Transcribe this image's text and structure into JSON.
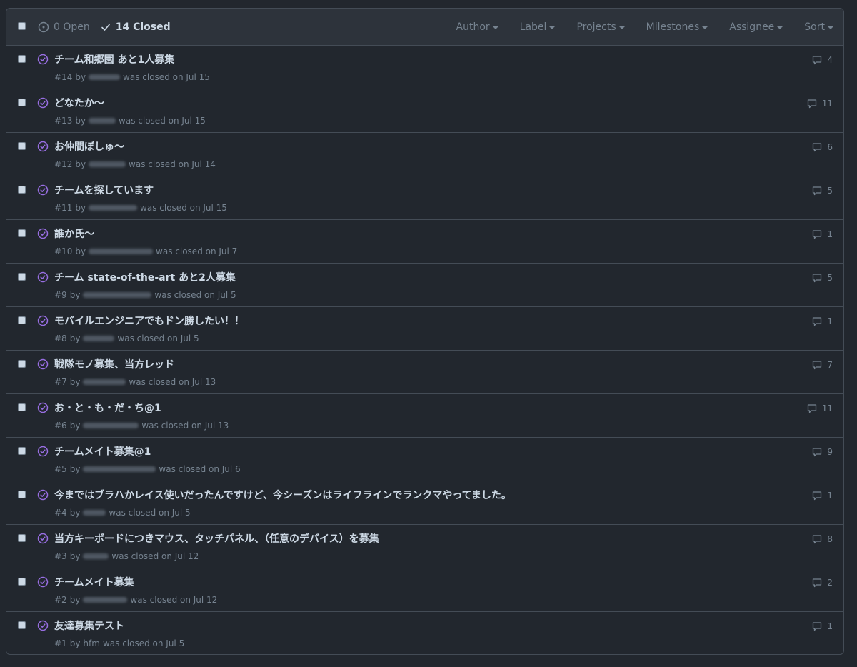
{
  "header": {
    "open_label": "0 Open",
    "closed_label": "14 Closed",
    "filters": [
      "Author",
      "Label",
      "Projects",
      "Milestones",
      "Assignee",
      "Sort"
    ]
  },
  "issues": [
    {
      "title": "チーム和郷園 あと1人募集",
      "number": "#14",
      "by": "by",
      "author": "",
      "status": "was closed on Jul 15",
      "comments": "4"
    },
    {
      "title": "どなたか〜",
      "number": "#13",
      "by": "by",
      "author": "",
      "status": "was closed on Jul 15",
      "comments": "11"
    },
    {
      "title": "お仲間ぼしゅ〜",
      "number": "#12",
      "by": "by",
      "author": "",
      "status": "was closed on Jul 14",
      "comments": "6"
    },
    {
      "title": "チームを探しています",
      "number": "#11",
      "by": "by",
      "author": "",
      "status": "was closed on Jul 15",
      "comments": "5"
    },
    {
      "title": "誰か氏〜",
      "number": "#10",
      "by": "by",
      "author": "",
      "status": "was closed on Jul 7",
      "comments": "1"
    },
    {
      "title": "チーム state-of-the-art あと2人募集",
      "number": "#9",
      "by": "by",
      "author": "",
      "status": "was closed on Jul 5",
      "comments": "5"
    },
    {
      "title": "モバイルエンジニアでもドン勝したい！！",
      "number": "#8",
      "by": "by",
      "author": "",
      "status": "was closed on Jul 5",
      "comments": "1"
    },
    {
      "title": "戦隊モノ募集、当方レッド",
      "number": "#7",
      "by": "by",
      "author": "",
      "status": "was closed on Jul 13",
      "comments": "7"
    },
    {
      "title": "お・と・も・だ・ち@1",
      "number": "#6",
      "by": "by",
      "author": "",
      "status": "was closed on Jul 13",
      "comments": "11"
    },
    {
      "title": "チームメイト募集@1",
      "number": "#5",
      "by": "by",
      "author": "",
      "status": "was closed on Jul 6",
      "comments": "9"
    },
    {
      "title": "今まではブラハかレイス使いだったんですけど、今シーズンはライフラインでランクマやってました。",
      "number": "#4",
      "by": "by",
      "author": "",
      "status": "was closed on Jul 5",
      "comments": "1"
    },
    {
      "title": "当方キーボードにつきマウス、タッチパネル、（任意のデバイス）を募集",
      "number": "#3",
      "by": "by",
      "author": "",
      "status": "was closed on Jul 12",
      "comments": "8"
    },
    {
      "title": "チームメイト募集",
      "number": "#2",
      "by": "by",
      "author": "",
      "status": "was closed on Jul 12",
      "comments": "2"
    },
    {
      "title": "友達募集テスト",
      "number": "#1",
      "by": "by",
      "author": "hfm",
      "status": "was closed on Jul 5",
      "comments": "1"
    }
  ],
  "colors": {
    "accent_closed": "#986ee2",
    "background": "#22272e",
    "header_bg": "#2d333b",
    "border": "#444c56"
  },
  "icons": {
    "open": "issue-opened-icon",
    "closed": "check-icon",
    "issue_state": "issue-closed-icon",
    "comment": "comment-icon"
  }
}
